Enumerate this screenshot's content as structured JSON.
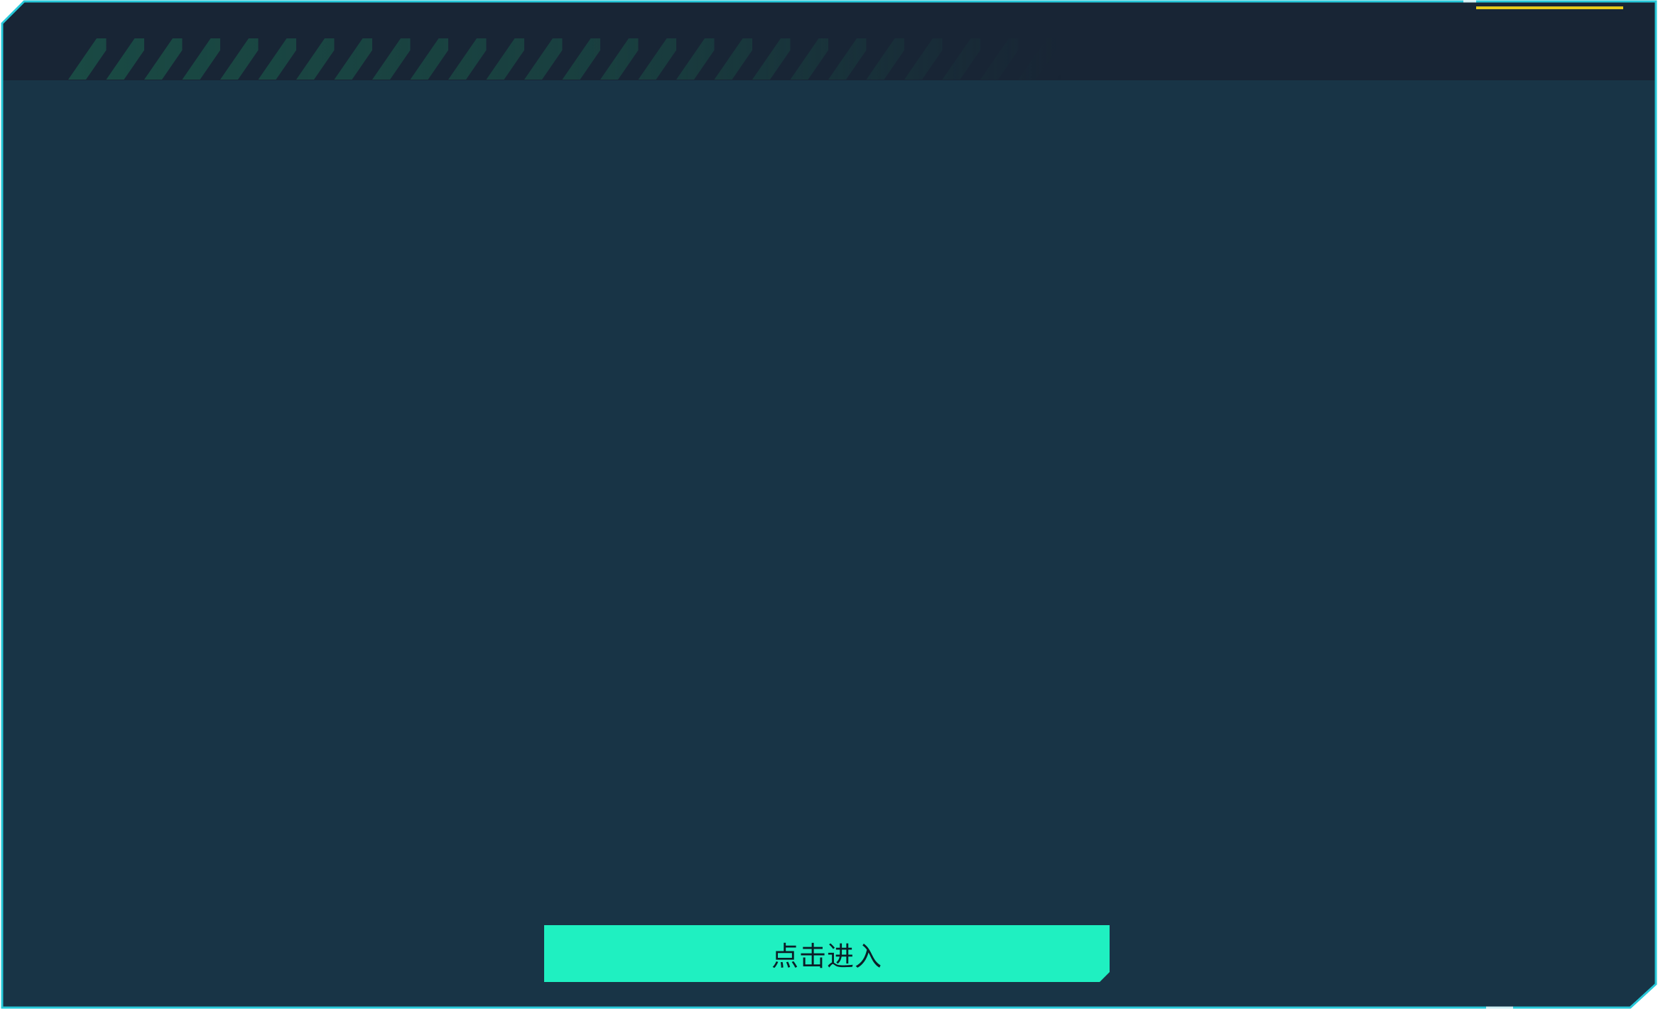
{
  "colors": {
    "frame_border": "#27c8d9",
    "header_bg": "#182535",
    "body_bg": "#183446",
    "stripe": "#1a4a44",
    "accent": "#e6c81b",
    "button_bg": "#1ff0c1",
    "button_text": "#0c1d27"
  },
  "button": {
    "label": "点击进入"
  }
}
